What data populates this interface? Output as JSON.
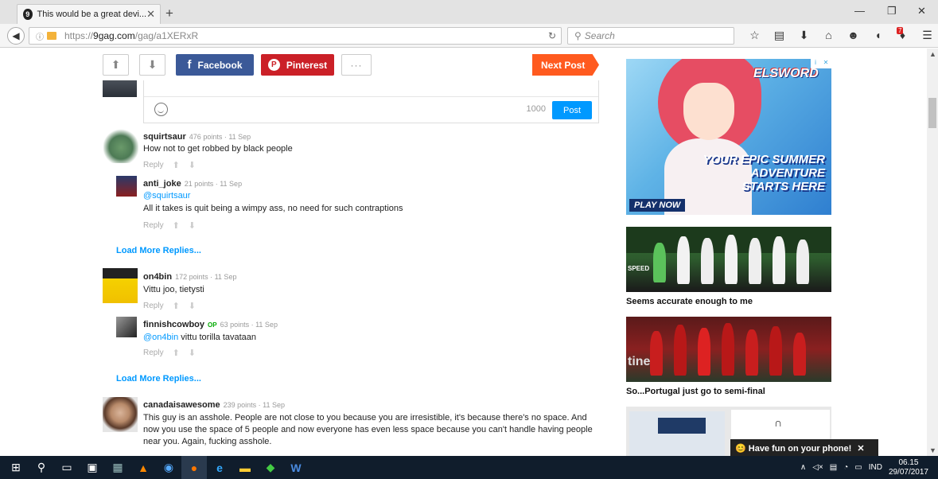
{
  "browser": {
    "tab_title": "This would be a great devi...",
    "tab_close": "✕",
    "new_tab": "+",
    "url_prefix": "https://",
    "url_domain": "9gag.com",
    "url_path": "/gag/a1XERxR",
    "search_placeholder": "Search",
    "notification_count": "7"
  },
  "post_actions": {
    "facebook_label": "Facebook",
    "pinterest_label": "Pinterest",
    "more_label": "···",
    "next_post_label": "Next Post"
  },
  "composer": {
    "char_count": "1000",
    "post_label": "Post"
  },
  "comments": [
    {
      "user": "squirtsaur",
      "meta": "476 points · 11 Sep",
      "text": "How not to get robbed by black people",
      "reply": "Reply"
    },
    {
      "user": "anti_joke",
      "meta": "21 points · 11 Sep",
      "mention": "@squirtsaur",
      "text": "All it takes is quit being a wimpy ass, no need for such contraptions",
      "reply": "Reply"
    },
    {
      "user": "on4bin",
      "meta": "172 points · 11 Sep",
      "text": "Vittu joo, tietysti",
      "reply": "Reply"
    },
    {
      "user": "finnishcowboy",
      "op": "OP",
      "meta": "63 points · 11 Sep",
      "mention": "@on4bin",
      "text": " vittu torilla tavataan",
      "reply": "Reply"
    },
    {
      "user": "canadaisawesome",
      "meta": "239 points · 11 Sep",
      "text": "This guy is an asshole. People are not close to you because you are irresistible, it's because there's no space. And now you use the space of 5 people and now everyone has even less space because you can't handle having people near you. Again, fucking asshole."
    }
  ],
  "load_more": "Load More Replies...",
  "sidebar": {
    "ad": {
      "logo": "ELSWORD",
      "slogan_1": "YOUR EPIC SUMMER ADVENTURE",
      "slogan_2": "STARTS HERE",
      "cta": "PLAY NOW"
    },
    "posts": [
      {
        "title": "Seems accurate enough to me"
      },
      {
        "title": "So...Portugal just go to semi-final"
      }
    ],
    "thumb1_text": "SPEED",
    "thumb2_text": "tine"
  },
  "toast": {
    "text": "😊 Have fun on your phone!",
    "close": "✕"
  },
  "taskbar": {
    "language": "IND",
    "time": "06.15",
    "date": "29/07/2017"
  }
}
